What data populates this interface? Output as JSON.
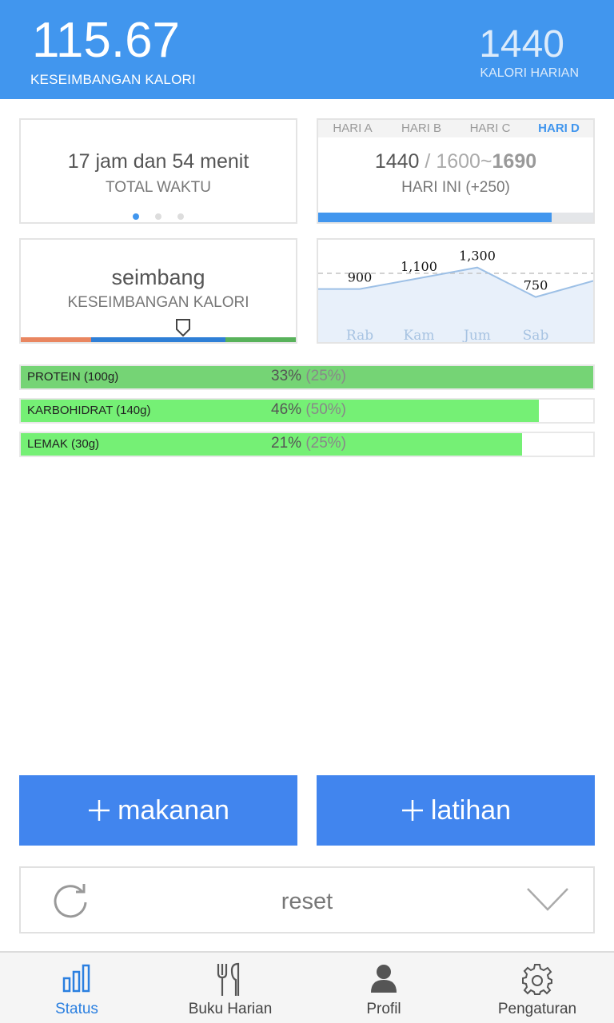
{
  "header": {
    "balance_value": "115.67",
    "balance_label": "KESEIMBANGAN KALORI",
    "daily_value": "1440",
    "daily_label": "KALORI HARIAN"
  },
  "time_card": {
    "main": "17 jam dan 54 menit",
    "sub": "TOTAL WAKTU",
    "page_count": 3,
    "active_page": 0
  },
  "day_card": {
    "tabs": [
      "HARI A",
      "HARI B",
      "HARI C",
      "HARI D"
    ],
    "active_tab": 3,
    "value": "1440",
    "separator": " / ",
    "range_low": "1600~",
    "range_high": "1690",
    "sub": "HARI INI (+250)",
    "progress": 0.85
  },
  "balance_card": {
    "main": "seimbang",
    "sub": "KESEIMBANGAN KALORI"
  },
  "chart_data": {
    "type": "area",
    "categories": [
      "Rab",
      "Kam",
      "Jum",
      "Sab"
    ],
    "values": [
      900,
      1100,
      1300,
      750
    ],
    "value_labels": [
      "900",
      "1,100",
      "1,300",
      "750"
    ],
    "reference_line": 1440,
    "ylim": [
      0,
      1500
    ],
    "grid": false
  },
  "macros": [
    {
      "name": "PROTEIN (100g)",
      "pct": "33%",
      "target": "(25%)",
      "fill": 1.0,
      "color": "#75d475"
    },
    {
      "name": "KARBOHIDRAT (140g)",
      "pct": "46%",
      "target": "(50%)",
      "fill": 0.905,
      "color": "#75f075"
    },
    {
      "name": "LEMAK (30g)",
      "pct": "21%",
      "target": "(25%)",
      "fill": 0.875,
      "color": "#75f075"
    }
  ],
  "actions": {
    "food_label": "makanan",
    "exercise_label": "latihan"
  },
  "reset": {
    "label": "reset"
  },
  "nav": [
    {
      "label": "Status",
      "icon": "bar-chart-icon",
      "active": true
    },
    {
      "label": "Buku Harian",
      "icon": "fork-knife-icon",
      "active": false
    },
    {
      "label": "Profil",
      "icon": "user-icon",
      "active": false
    },
    {
      "label": "Pengaturan",
      "icon": "gear-icon",
      "active": false
    }
  ],
  "colors": {
    "header": "#4196ee",
    "action_button": "#4185ee",
    "progress": "#4196ee",
    "nav_active": "#2a7fe0"
  }
}
